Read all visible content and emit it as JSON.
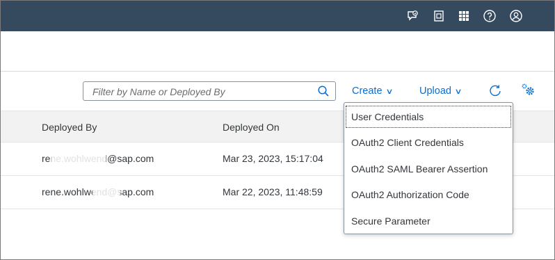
{
  "shellbar": {
    "icons": [
      "feedback-icon",
      "notes-icon",
      "product-switch-icon",
      "help-icon",
      "user-icon"
    ]
  },
  "search": {
    "placeholder": "Filter by Name or Deployed By"
  },
  "toolbar": {
    "create_label": "Create",
    "upload_label": "Upload"
  },
  "table": {
    "columns": [
      "Deployed By",
      "Deployed On"
    ],
    "rows": [
      {
        "deployed_by": "rene.wohlwend@sap.com",
        "deployed_on": "Mar 23, 2023, 15:17:04"
      },
      {
        "deployed_by": "rene.wohlwend@sap.com",
        "deployed_on": "Mar 22, 2023, 11:48:59"
      }
    ]
  },
  "create_menu": {
    "items": [
      "User Credentials",
      "OAuth2 Client Credentials",
      "OAuth2 SAML Bearer Assertion",
      "OAuth2 Authorization Code",
      "Secure Parameter"
    ]
  },
  "colors": {
    "shellbar": "#354a5f",
    "link": "#0a6ed1",
    "text": "#32363a"
  }
}
